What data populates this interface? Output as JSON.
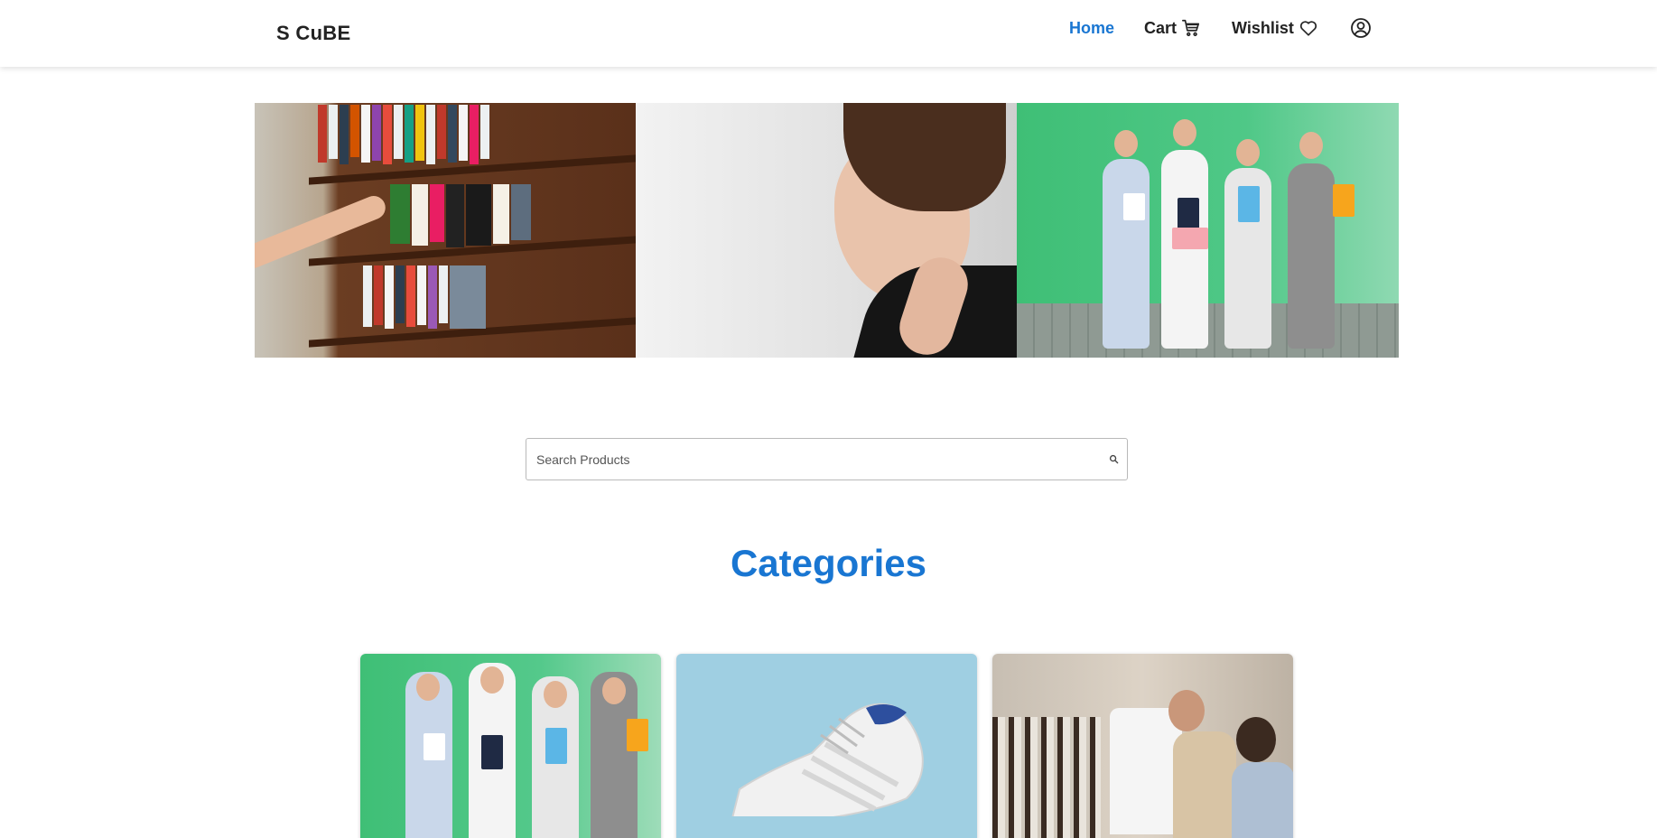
{
  "brand": "S CuBE",
  "nav": {
    "home": "Home",
    "cart": "Cart",
    "wishlist": "Wishlist",
    "icons": {
      "cart": "cart-icon",
      "wishlist": "heart-icon",
      "profile": "user-circle-icon"
    }
  },
  "hero": {
    "panels": [
      {
        "name": "bookshelf"
      },
      {
        "name": "jewelry-model"
      },
      {
        "name": "shopping-friends"
      }
    ]
  },
  "search": {
    "placeholder": "Search Products",
    "value": "",
    "icon": "search-icon"
  },
  "categories": {
    "title": "Categories",
    "cards": [
      {
        "name": "clothing-shoppers"
      },
      {
        "name": "sneaker"
      },
      {
        "name": "apparel-store"
      }
    ]
  },
  "colors": {
    "accent": "#1976d2",
    "text": "#222222",
    "border": "#b9b9b9"
  }
}
